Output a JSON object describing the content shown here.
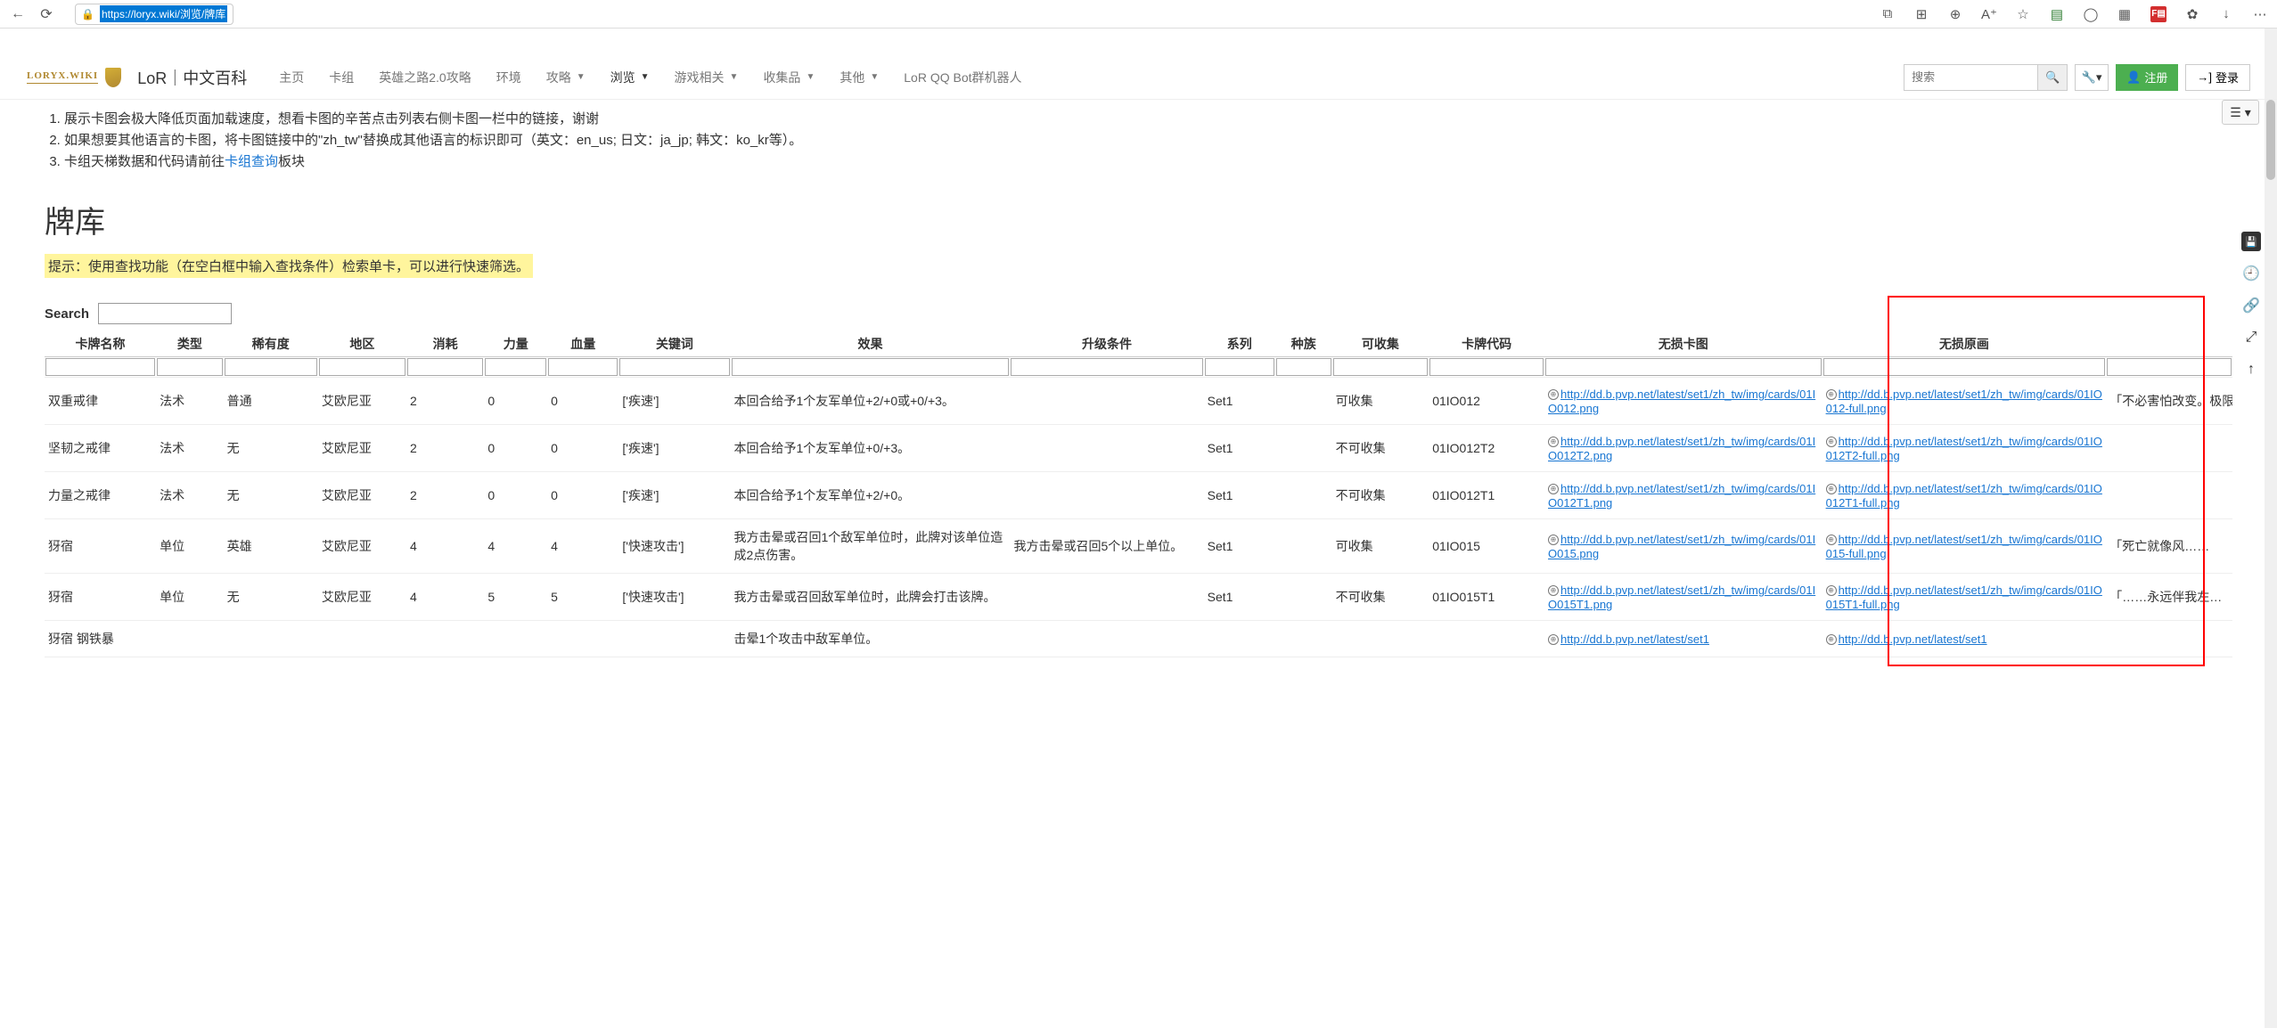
{
  "browser": {
    "url": "https://loryx.wiki/浏览/牌库"
  },
  "header": {
    "logo_text": "LORYX.WIKI",
    "site_title": "LoR｜中文百科",
    "nav": [
      {
        "label": "主页",
        "has_dropdown": false,
        "active": false
      },
      {
        "label": "卡组",
        "has_dropdown": false,
        "active": false
      },
      {
        "label": "英雄之路2.0攻略",
        "has_dropdown": false,
        "active": false
      },
      {
        "label": "环境",
        "has_dropdown": false,
        "active": false
      },
      {
        "label": "攻略",
        "has_dropdown": true,
        "active": false
      },
      {
        "label": "浏览",
        "has_dropdown": true,
        "active": true
      },
      {
        "label": "游戏相关",
        "has_dropdown": true,
        "active": false
      },
      {
        "label": "收集品",
        "has_dropdown": true,
        "active": false
      },
      {
        "label": "其他",
        "has_dropdown": true,
        "active": false
      },
      {
        "label": "LoR QQ Bot群机器人",
        "has_dropdown": false,
        "active": false
      }
    ],
    "search_placeholder": "搜索",
    "register_label": "注册",
    "login_label": "登录"
  },
  "notes": {
    "n1a": "展示卡图会极大降低页面加载速度，想看卡图的辛苦点击列表右侧卡图一栏中的链接，谢谢",
    "n2a": "如果想要其他语言的卡图，将卡图链接中的\"zh_tw\"替换成其他语言的标识即可（英文：en_us; 日文：ja_jp; 韩文：ko_kr等）。",
    "n3a": "卡组天梯数据和代码请前往",
    "n3link": "卡组查询",
    "n3b": "板块"
  },
  "page": {
    "title": "牌库",
    "tip": "提示：使用查找功能（在空白框中输入查找条件）检索单卡，可以进行快速筛选。",
    "search_label": "Search"
  },
  "columns": [
    "卡牌名称",
    "类型",
    "稀有度",
    "地区",
    "消耗",
    "力量",
    "血量",
    "关键词",
    "效果",
    "升级条件",
    "系列",
    "种族",
    "可收集",
    "卡牌代码",
    "无损卡图",
    "无损原画",
    ""
  ],
  "rows": [
    {
      "name": "双重戒律",
      "type": "法术",
      "rarity": "普通",
      "region": "艾欧尼亚",
      "cost": "2",
      "power": "0",
      "health": "0",
      "keywords": "['疾速']",
      "effect": "本回合给予1个友军单位+2/+0或+0/+3。",
      "upgrade": "",
      "series": "Set1",
      "race": "",
      "collect": "可收集",
      "code": "01IO012",
      "img_url": "http://dd.b.pvp.net/latest/set1/zh_tw/img/cards/01IO012.png",
      "full_url": "http://dd.b.pvp.net/latest/set1/zh_tw/img/cards/01IO012-full.png",
      "flavor": "「不必害怕改变。极限，是我们最…"
    },
    {
      "name": "坚韧之戒律",
      "type": "法术",
      "rarity": "无",
      "region": "艾欧尼亚",
      "cost": "2",
      "power": "0",
      "health": "0",
      "keywords": "['疾速']",
      "effect": "本回合给予1个友军单位+0/+3。",
      "upgrade": "",
      "series": "Set1",
      "race": "",
      "collect": "不可收集",
      "code": "01IO012T2",
      "img_url": "http://dd.b.pvp.net/latest/set1/zh_tw/img/cards/01IO012T2.png",
      "full_url": "http://dd.b.pvp.net/latest/set1/zh_tw/img/cards/01IO012T2-full.png",
      "flavor": ""
    },
    {
      "name": "力量之戒律",
      "type": "法术",
      "rarity": "无",
      "region": "艾欧尼亚",
      "cost": "2",
      "power": "0",
      "health": "0",
      "keywords": "['疾速']",
      "effect": "本回合给予1个友军单位+2/+0。",
      "upgrade": "",
      "series": "Set1",
      "race": "",
      "collect": "不可收集",
      "code": "01IO012T1",
      "img_url": "http://dd.b.pvp.net/latest/set1/zh_tw/img/cards/01IO012T1.png",
      "full_url": "http://dd.b.pvp.net/latest/set1/zh_tw/img/cards/01IO012T1-full.png",
      "flavor": ""
    },
    {
      "name": "犽宿",
      "type": "单位",
      "rarity": "英雄",
      "region": "艾欧尼亚",
      "cost": "4",
      "power": "4",
      "health": "4",
      "keywords": "['快速攻击']",
      "effect": "我方击晕或召回1个敌军单位时，此牌对该单位造成2点伤害。",
      "upgrade": "我方击晕或召回5个以上单位。",
      "series": "Set1",
      "race": "",
      "collect": "可收集",
      "code": "01IO015",
      "img_url": "http://dd.b.pvp.net/latest/set1/zh_tw/img/cards/01IO015.png",
      "full_url": "http://dd.b.pvp.net/latest/set1/zh_tw/img/cards/01IO015-full.png",
      "flavor": "「死亡就像风……"
    },
    {
      "name": "犽宿",
      "type": "单位",
      "rarity": "无",
      "region": "艾欧尼亚",
      "cost": "4",
      "power": "5",
      "health": "5",
      "keywords": "['快速攻击']",
      "effect": "我方击晕或召回敌军单位时，此牌会打击该牌。",
      "upgrade": "",
      "series": "Set1",
      "race": "",
      "collect": "不可收集",
      "code": "01IO015T1",
      "img_url": "http://dd.b.pvp.net/latest/set1/zh_tw/img/cards/01IO015T1.png",
      "full_url": "http://dd.b.pvp.net/latest/set1/zh_tw/img/cards/01IO015T1-full.png",
      "flavor": "「……永远伴我左…"
    },
    {
      "name": "犽宿 钢铁暴",
      "type": "",
      "rarity": "",
      "region": "",
      "cost": "",
      "power": "",
      "health": "",
      "keywords": "",
      "effect": "击晕1个攻击中敌军单位。",
      "upgrade": "",
      "series": "",
      "race": "",
      "collect": "",
      "code": "",
      "img_url": "http://dd.b.pvp.net/latest/set1",
      "full_url": "http://dd.b.pvp.net/latest/set1",
      "flavor": ""
    }
  ]
}
